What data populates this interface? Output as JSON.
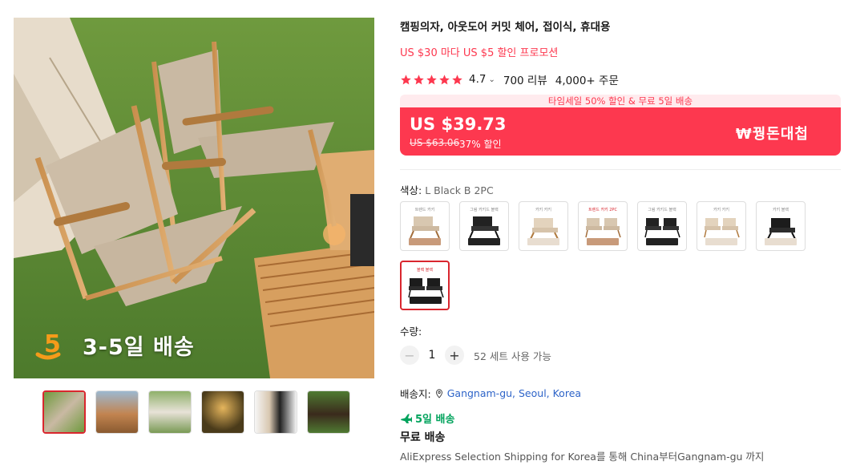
{
  "product": {
    "title": "캠핑의자, 아웃도어 커밋 체어, 접이식, 휴대용",
    "promo": "US $30 마다 US $5 할인 프로모션",
    "rating": "4.7",
    "reviews": "700 리뷰",
    "orders": "4,000+ 주문",
    "stars": 5
  },
  "image": {
    "badge_text": "3-5일 배송"
  },
  "price": {
    "sale_banner": "타임세일 50% 할인 & 무료 5일 배송",
    "current": "US $39.73",
    "original": "US $63.06",
    "discount": "37% 할인",
    "deal_label": "₩꿩돈대첩"
  },
  "color": {
    "label": "색상: ",
    "value": "L Black B 2PC",
    "options": [
      {
        "name": "khaki-single",
        "caption": "트렌드 카키",
        "tone": "khaki",
        "count": 1
      },
      {
        "name": "black-single",
        "caption": "그림 카키드 블랙",
        "tone": "black",
        "count": 1
      },
      {
        "name": "khaki-single-2",
        "caption": "카키 카키",
        "tone": "khaki",
        "count": 1
      },
      {
        "name": "khaki-double",
        "caption": "트렌드 카키 2PC",
        "tone": "khaki",
        "count": 2
      },
      {
        "name": "black-double",
        "caption": "그림 카키드 블랙",
        "tone": "black",
        "count": 2
      },
      {
        "name": "khaki-double-2",
        "caption": "카키 카키",
        "tone": "khaki",
        "count": 2
      },
      {
        "name": "black-single-2",
        "caption": "카키 블랙",
        "tone": "black",
        "count": 1
      },
      {
        "name": "black-double-selected",
        "caption": "블랙 블랙",
        "tone": "black",
        "count": 2
      }
    ]
  },
  "quantity": {
    "label": "수량:",
    "value": "1",
    "available": "52 세트 사용 가능"
  },
  "shipping": {
    "to_label": "배송지:",
    "location": "Gangnam-gu, Seoul, Korea",
    "fast": "5일 배송",
    "free": "무료 배송",
    "via": "AliExpress Selection Shipping for Korea를 통해 China부터Gangnam-gu 까지"
  },
  "colors": {
    "accent": "#fd384f",
    "link": "#2e64c8",
    "green": "#00a35c",
    "star": "#fd384f"
  }
}
